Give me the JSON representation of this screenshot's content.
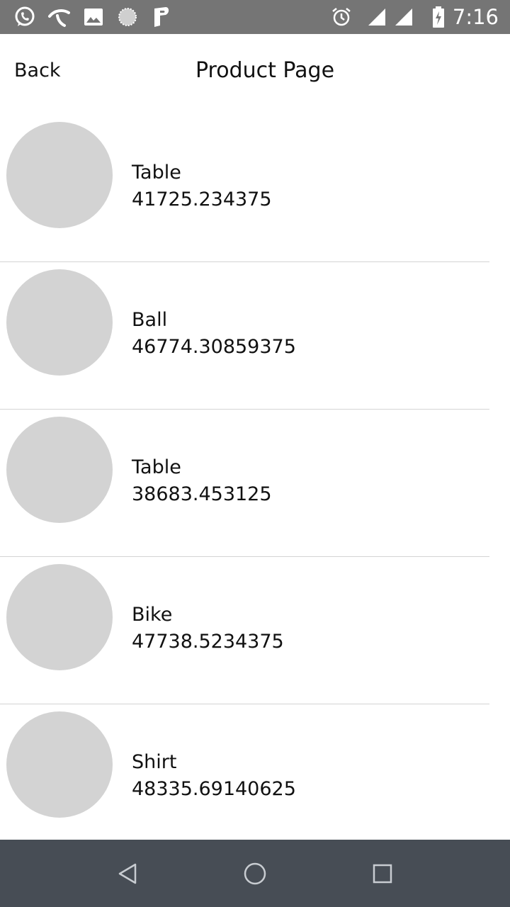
{
  "status_bar": {
    "time": "7:16",
    "left_icons": [
      "whatsapp-icon",
      "telenor-icon",
      "gallery-icon",
      "sync-icon",
      "parking-icon"
    ],
    "right_icons": [
      "alarm-icon",
      "signal-icon",
      "signal-icon",
      "battery-charging-icon"
    ]
  },
  "header": {
    "back_label": "Back",
    "title": "Product Page"
  },
  "products": [
    {
      "name": "Table",
      "price": "41725.234375"
    },
    {
      "name": "Ball",
      "price": "46774.30859375"
    },
    {
      "name": "Table",
      "price": "38683.453125"
    },
    {
      "name": "Bike",
      "price": "47738.5234375"
    },
    {
      "name": "Shirt",
      "price": "48335.69140625"
    }
  ],
  "nav_bar": {
    "buttons": [
      "back-triangle-icon",
      "home-circle-icon",
      "recents-square-icon"
    ]
  },
  "colors": {
    "status_bar": "#757575",
    "nav_bar": "#474d55",
    "avatar_placeholder": "#d3d3d3",
    "divider": "#d4d4d4"
  }
}
